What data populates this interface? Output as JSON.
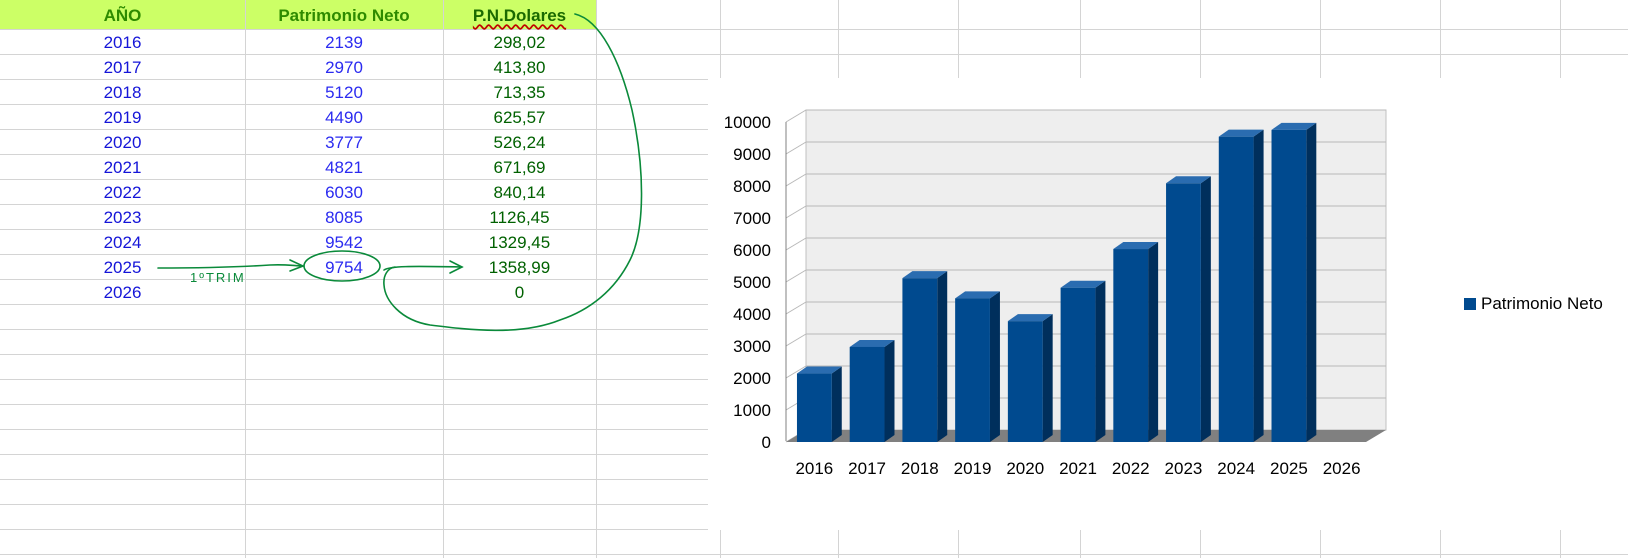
{
  "sheet": {
    "headers": {
      "year": "AÑO",
      "patrimonio": "Patrimonio Neto",
      "dolares": "P.N.Dolares"
    },
    "rows": [
      {
        "year": "2016",
        "patrimonio": "2139",
        "dolares": "298,02"
      },
      {
        "year": "2017",
        "patrimonio": "2970",
        "dolares": "413,80"
      },
      {
        "year": "2018",
        "patrimonio": "5120",
        "dolares": "713,35"
      },
      {
        "year": "2019",
        "patrimonio": "4490",
        "dolares": "625,57"
      },
      {
        "year": "2020",
        "patrimonio": "3777",
        "dolares": "526,24"
      },
      {
        "year": "2021",
        "patrimonio": "4821",
        "dolares": "671,69"
      },
      {
        "year": "2022",
        "patrimonio": "6030",
        "dolares": "840,14"
      },
      {
        "year": "2023",
        "patrimonio": "8085",
        "dolares": "1126,45"
      },
      {
        "year": "2024",
        "patrimonio": "9542",
        "dolares": "1329,45"
      },
      {
        "year": "2025",
        "patrimonio": "9754",
        "dolares": "1358,99"
      },
      {
        "year": "2026",
        "patrimonio": "",
        "dolares": "0"
      }
    ],
    "annotation": "1ºTRIM"
  },
  "colors": {
    "header_bg": "#ccff66",
    "bar": "#004a8f",
    "ink": "#0a8a3a"
  },
  "chart_data": {
    "type": "bar",
    "categories": [
      "2016",
      "2017",
      "2018",
      "2019",
      "2020",
      "2021",
      "2022",
      "2023",
      "2024",
      "2025",
      "2026"
    ],
    "series": [
      {
        "name": "Patrimonio Neto",
        "values": [
          2139,
          2970,
          5120,
          4490,
          3777,
          4821,
          6030,
          8085,
          9542,
          9754,
          null
        ]
      }
    ],
    "ylim": [
      0,
      10000
    ],
    "yticks": [
      0,
      1000,
      2000,
      3000,
      4000,
      5000,
      6000,
      7000,
      8000,
      9000,
      10000
    ],
    "grid": true,
    "legend": "right",
    "style": "3d"
  }
}
